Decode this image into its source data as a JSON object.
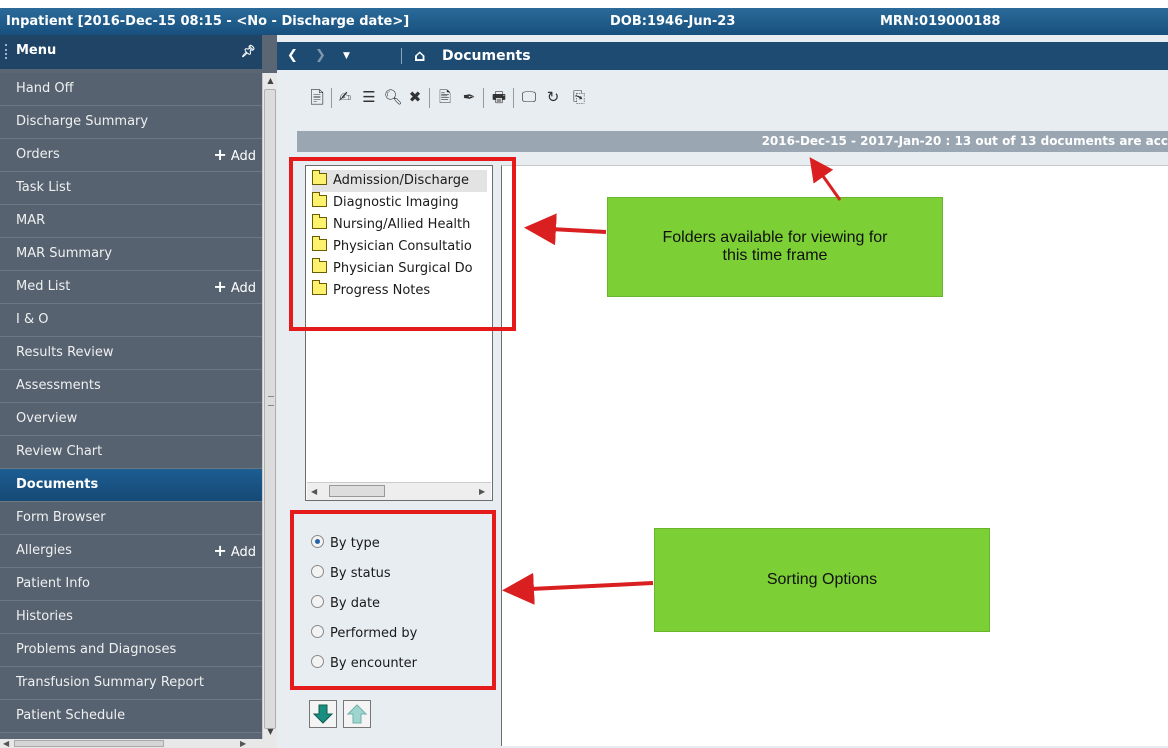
{
  "window": {
    "title": "Inpatient [2016-Dec-15 08:15 - <No - Discharge date>]",
    "dob": "DOB:1946-Jun-23",
    "mrn": "MRN:019000188"
  },
  "sidebar": {
    "header": "Menu",
    "items": [
      {
        "label": "Hand Off"
      },
      {
        "label": "Discharge Summary"
      },
      {
        "label": "Orders",
        "add": "Add"
      },
      {
        "label": "Task List"
      },
      {
        "label": "MAR"
      },
      {
        "label": "MAR Summary"
      },
      {
        "label": "Med List",
        "add": "Add"
      },
      {
        "label": "I & O"
      },
      {
        "label": "Results Review"
      },
      {
        "label": "Assessments"
      },
      {
        "label": "Overview"
      },
      {
        "label": "Review Chart"
      },
      {
        "label": "Documents",
        "active": true
      },
      {
        "label": "Form Browser"
      },
      {
        "label": "Allergies",
        "add": "Add"
      },
      {
        "label": "Patient Info"
      },
      {
        "label": "Histories"
      },
      {
        "label": "Problems and Diagnoses"
      },
      {
        "label": "Transfusion Summary Report"
      },
      {
        "label": "Patient Schedule"
      }
    ]
  },
  "nav": {
    "title": "Documents"
  },
  "documents": {
    "banner": "2016-Dec-15 - 2017-Jan-20 : 13 out of 13 documents are acc",
    "folders": [
      "Admission/Discharge",
      "Diagnostic Imaging",
      "Nursing/Allied Health",
      "Physician Consultatio",
      "Physician Surgical Do",
      "Progress Notes"
    ],
    "sort_options": [
      "By type",
      "By status",
      "By date",
      "Performed by",
      "By encounter"
    ],
    "sort_selected": "By type"
  },
  "annotations": {
    "folders_note": "Folders available for viewing for this time frame",
    "sorting_note": "Sorting Options"
  },
  "colors": {
    "callout_border": "#e51a1a",
    "callout_fill": "#7ccf35",
    "active_menu": "#1c5d92"
  }
}
